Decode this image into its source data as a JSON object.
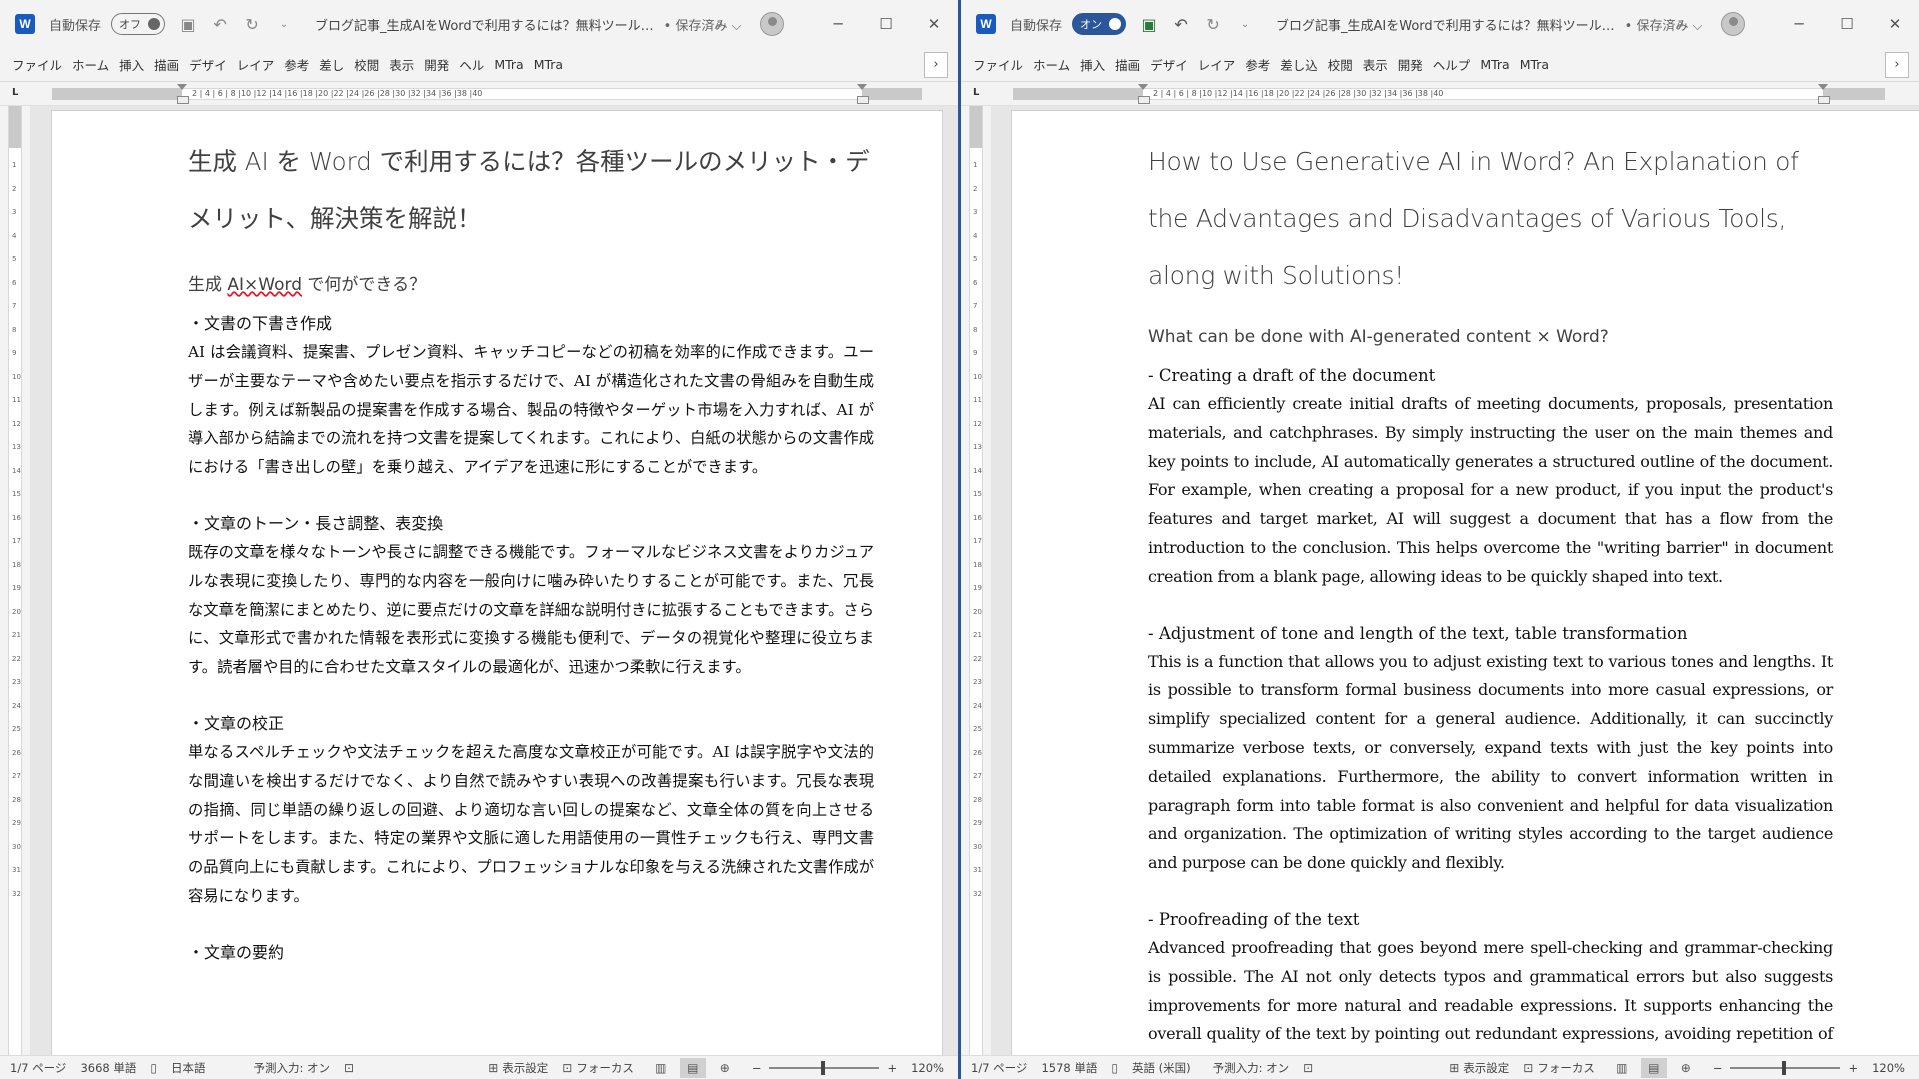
{
  "windows": {
    "left": {
      "title": "ブログ記事_生成AIをWordで利用するには？無料ツール…",
      "save_state": "• 保存済み ⌵",
      "autosave_label": "自動保存",
      "autosave_state": "オフ",
      "ribbon_tabs": [
        "ファイル",
        "ホーム",
        "挿入",
        "描画",
        "デザイ",
        "レイア",
        "参考",
        "差し",
        "校閲",
        "表示",
        "開発",
        "ヘル",
        "MTra",
        "MTra"
      ],
      "ruler_numbers": "2 | 4 | 6 | 8 |10 |12 |14 |16 |18 |20 |22 |24 |26 |28 |30 |32 |34 |36 |38 |40",
      "heading": "生成 AI を Word で利用するには？各種ツールのメリット・デメリット、解決策を解説！",
      "subheading_pre": "生成 ",
      "subheading_err": "AI×Word",
      "subheading_post": " で何ができる？",
      "sections": [
        {
          "title": "・文書の下書き作成",
          "body": "AI は会議資料、提案書、プレゼン資料、キャッチコピーなどの初稿を効率的に作成できます。ユーザーが主要なテーマや含めたい要点を指示するだけで、AI が構造化された文書の骨組みを自動生成します。例えば新製品の提案書を作成する場合、製品の特徴やターゲット市場を入力すれば、AI が導入部から結論までの流れを持つ文書を提案してくれます。これにより、白紙の状態からの文書作成における「書き出しの壁」を乗り越え、アイデアを迅速に形にすることができます。"
        },
        {
          "title": "・文章のトーン・長さ調整、表変換",
          "body": "既存の文章を様々なトーンや長さに調整できる機能です。フォーマルなビジネス文書をよりカジュアルな表現に変換したり、専門的な内容を一般向けに噛み砕いたりすることが可能です。また、冗長な文章を簡潔にまとめたり、逆に要点だけの文章を詳細な説明付きに拡張することもできます。さらに、文章形式で書かれた情報を表形式に変換する機能も便利で、データの視覚化や整理に役立ちます。読者層や目的に合わせた文章スタイルの最適化が、迅速かつ柔軟に行えます。"
        },
        {
          "title": "・文章の校正",
          "body": "単なるスペルチェックや文法チェックを超えた高度な文章校正が可能です。AI は誤字脱字や文法的な間違いを検出するだけでなく、より自然で読みやすい表現への改善提案も行います。冗長な表現の指摘、同じ単語の繰り返しの回避、より適切な言い回しの提案など、文章全体の質を向上させるサポートをします。また、特定の業界や文脈に適した用語使用の一貫性チェックも行え、専門文書の品質向上にも貢献します。これにより、プロフェッショナルな印象を与える洗練された文書作成が容易になります。"
        },
        {
          "title": "・文章の要約",
          "body": ""
        }
      ],
      "status": {
        "page": "1/7 ページ",
        "words": "3668 単語",
        "language": "日本語",
        "predict": "予測入力: オン",
        "display_settings": "表示設定",
        "focus": "フォーカス",
        "zoom": "120%"
      }
    },
    "right": {
      "title": "ブログ記事_生成AIをWordで利用するには？無料ツール…",
      "save_state": "• 保存済み ⌵",
      "autosave_label": "自動保存",
      "autosave_state": "オン",
      "ribbon_tabs": [
        "ファイル",
        "ホーム",
        "挿入",
        "描画",
        "デザイ",
        "レイア",
        "参考",
        "差し込",
        "校閲",
        "表示",
        "開発",
        "ヘルプ",
        "MTra",
        "MTra"
      ],
      "ruler_numbers": "2 | 4 | 6 | 8 |10 |12 |14 |16 |18 |20 |22 |24 |26 |28 |30 |32 |34 |36 |38 |40",
      "heading": "How to Use Generative AI in Word? An Explanation of the Advantages and Disadvantages of Various Tools, along with Solutions!",
      "subheading": "What can be done with AI-generated content  ×  Word?",
      "sections": [
        {
          "title": "- Creating a draft of the document",
          "body": "AI can efficiently create initial drafts of meeting documents, proposals, presentation materials, and catchphrases. By simply instructing the user on the main themes and key points to include, AI automatically generates a structured outline of the document. For example, when creating a proposal for a new product, if you input the product's features and target market, AI will suggest a document that has a flow from the introduction to the conclusion. This helps overcome the \"writing barrier\" in document creation from a blank page, allowing ideas to be quickly shaped into text."
        },
        {
          "title": "- Adjustment of tone and length of the text, table transformation",
          "body": "This is a function that allows you to adjust existing text to various tones and lengths. It is possible to transform formal business documents into more casual expressions, or simplify specialized content for a general audience. Additionally, it can succinctly summarize verbose texts, or conversely, expand texts with just the key points into detailed explanations. Furthermore, the ability to convert information written in paragraph form into table format is also convenient and helpful for data visualization and organization. The optimization of writing styles according to the target audience and purpose can be done quickly and flexibly."
        },
        {
          "title": "- Proofreading of the text",
          "body": "Advanced proofreading that goes beyond mere spell-checking and grammar-checking is possible. The AI not only detects typos and grammatical errors but also suggests improvements for more natural and readable expressions. It supports enhancing the overall quality of the text by pointing out redundant expressions, avoiding repetition of the same"
        }
      ],
      "status": {
        "page": "1/7 ページ",
        "words": "1578 単語",
        "language": "英語 (米国)",
        "predict": "予測入力: オン",
        "display_settings": "表示設定",
        "focus": "フォーカス",
        "zoom": "120%"
      }
    }
  },
  "icons": {
    "word_logo": "W",
    "save": "save-icon",
    "undo": "undo-icon",
    "redo": "redo-icon",
    "search": "search-icon"
  },
  "colors": {
    "accent": "#2b579a",
    "word_blue": "#185abd",
    "spell_error": "#e81123"
  },
  "vruler_numbers": [
    "1",
    "2",
    "3",
    "4",
    "5",
    "6",
    "7",
    "8",
    "9",
    "10",
    "11",
    "12",
    "13",
    "14",
    "15",
    "16",
    "17",
    "18",
    "19",
    "20",
    "21",
    "22",
    "23",
    "24",
    "25",
    "26",
    "27",
    "28",
    "29",
    "30",
    "31",
    "32"
  ]
}
